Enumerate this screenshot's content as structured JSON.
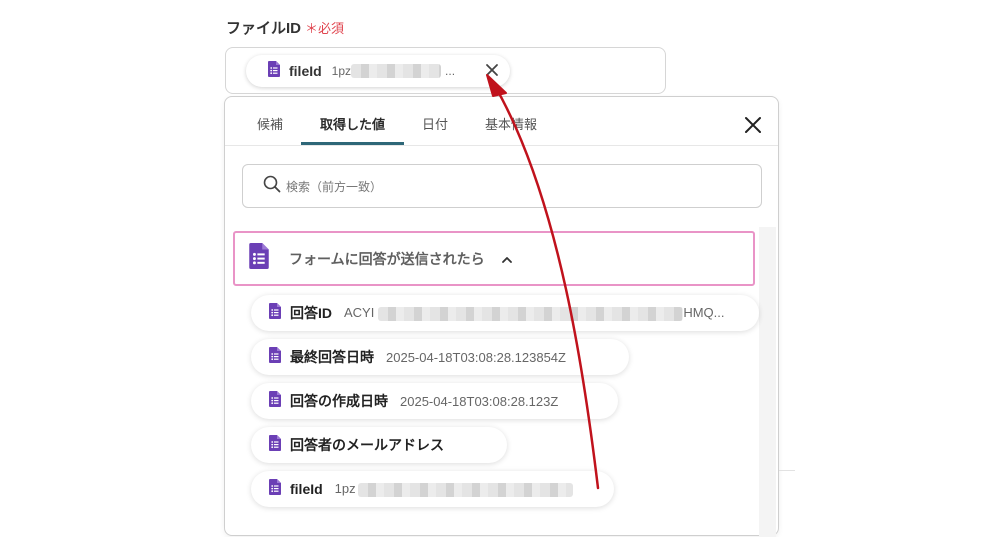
{
  "field": {
    "label": "ファイルID",
    "required_mark": "＊",
    "required_text": "必須"
  },
  "chip": {
    "name": "fileId",
    "value_prefix": "1pz",
    "ellipsis": "..."
  },
  "tabs": [
    {
      "label": "候補",
      "active": false
    },
    {
      "label": "取得した値",
      "active": true
    },
    {
      "label": "日付",
      "active": false
    },
    {
      "label": "基本情報",
      "active": false
    }
  ],
  "search": {
    "placeholder": "検索（前方一致）"
  },
  "group": {
    "label": "フォームに回答が送信されたら",
    "expanded": true
  },
  "items": [
    {
      "name": "回答ID",
      "value_prefix": "ACYI",
      "value_suffix": "HMQ..."
    },
    {
      "name": "最終回答日時",
      "value": "2025-04-18T03:08:28.123854Z"
    },
    {
      "name": "回答の作成日時",
      "value": "2025-04-18T03:08:28.123Z"
    },
    {
      "name": "回答者のメールアドレス",
      "value": ""
    },
    {
      "name": "fileId",
      "value_prefix": "1pz"
    }
  ],
  "colors": {
    "accent_tab": "#2e6778",
    "required": "#e0454f",
    "group_border": "#e994c7",
    "forms_icon": "#6b3fb5",
    "arrow": "#c0121c"
  },
  "icons": {
    "chip": "google-forms-icon",
    "remove": "close-icon",
    "dropdown_close": "close-icon",
    "search": "search-icon",
    "caret": "chevron-up-icon"
  }
}
